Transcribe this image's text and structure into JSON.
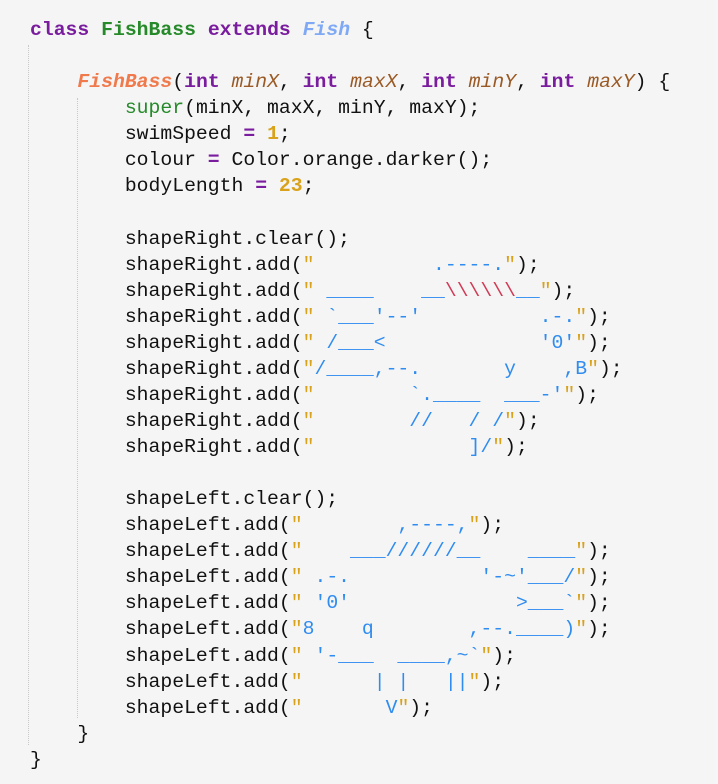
{
  "editor": {
    "colors": {
      "keyword": "#7a1c9e",
      "class_name": "#268a2a",
      "super_class": "#7fa9f5",
      "constructor": "#f07a4c",
      "param": "#9a5a26",
      "number": "#d9a21b",
      "string": "#2f8cf0",
      "escape": "#d03a55",
      "background": "#f5f5f5"
    },
    "lines": [
      [
        [
          "k",
          "class"
        ],
        [
          "t",
          " "
        ],
        [
          "c",
          "FishBass"
        ],
        [
          "t",
          " "
        ],
        [
          "k",
          "extends"
        ],
        [
          "t",
          " "
        ],
        [
          "ci",
          "Fish"
        ],
        [
          "t",
          " {"
        ]
      ],
      [],
      [
        [
          "t",
          "    "
        ],
        [
          "fn",
          "FishBass"
        ],
        [
          "t",
          "("
        ],
        [
          "k",
          "int"
        ],
        [
          "t",
          " "
        ],
        [
          "p",
          "minX"
        ],
        [
          "t",
          ", "
        ],
        [
          "k",
          "int"
        ],
        [
          "t",
          " "
        ],
        [
          "p",
          "maxX"
        ],
        [
          "t",
          ", "
        ],
        [
          "k",
          "int"
        ],
        [
          "t",
          " "
        ],
        [
          "p",
          "minY"
        ],
        [
          "t",
          ", "
        ],
        [
          "k",
          "int"
        ],
        [
          "t",
          " "
        ],
        [
          "p",
          "maxY"
        ],
        [
          "t",
          ") {"
        ]
      ],
      [
        [
          "t",
          "        "
        ],
        [
          "g",
          "super"
        ],
        [
          "t",
          "(minX, maxX, minY, maxY);"
        ]
      ],
      [
        [
          "t",
          "        swimSpeed "
        ],
        [
          "op",
          "="
        ],
        [
          "t",
          " "
        ],
        [
          "n",
          "1"
        ],
        [
          "t",
          ";"
        ]
      ],
      [
        [
          "t",
          "        colour "
        ],
        [
          "op",
          "="
        ],
        [
          "t",
          " Color.orange.darker();"
        ]
      ],
      [
        [
          "t",
          "        bodyLength "
        ],
        [
          "op",
          "="
        ],
        [
          "t",
          " "
        ],
        [
          "n",
          "23"
        ],
        [
          "t",
          ";"
        ]
      ],
      [],
      [
        [
          "t",
          "        shapeRight.clear();"
        ]
      ],
      [
        [
          "t",
          "        shapeRight.add("
        ],
        [
          "q",
          "\""
        ],
        [
          "s",
          "          .----."
        ],
        [
          "q",
          "\""
        ],
        [
          "t",
          ");"
        ]
      ],
      [
        [
          "t",
          "        shapeRight.add("
        ],
        [
          "q",
          "\""
        ],
        [
          "s",
          " ____    __"
        ],
        [
          "e",
          "\\\\\\\\\\\\"
        ],
        [
          "s",
          "__"
        ],
        [
          "q",
          "\""
        ],
        [
          "t",
          ");"
        ]
      ],
      [
        [
          "t",
          "        shapeRight.add("
        ],
        [
          "q",
          "\""
        ],
        [
          "s",
          " `___'--'          .-."
        ],
        [
          "q",
          "\""
        ],
        [
          "t",
          ");"
        ]
      ],
      [
        [
          "t",
          "        shapeRight.add("
        ],
        [
          "q",
          "\""
        ],
        [
          "s",
          " /___<             '0'"
        ],
        [
          "q",
          "\""
        ],
        [
          "t",
          ");"
        ]
      ],
      [
        [
          "t",
          "        shapeRight.add("
        ],
        [
          "q",
          "\""
        ],
        [
          "s",
          "/____,--.       y    ,B"
        ],
        [
          "q",
          "\""
        ],
        [
          "t",
          ");"
        ]
      ],
      [
        [
          "t",
          "        shapeRight.add("
        ],
        [
          "q",
          "\""
        ],
        [
          "s",
          "        `.____  ___-'"
        ],
        [
          "q",
          "\""
        ],
        [
          "t",
          ");"
        ]
      ],
      [
        [
          "t",
          "        shapeRight.add("
        ],
        [
          "q",
          "\""
        ],
        [
          "s",
          "        //   / /"
        ],
        [
          "q",
          "\""
        ],
        [
          "t",
          ");"
        ]
      ],
      [
        [
          "t",
          "        shapeRight.add("
        ],
        [
          "q",
          "\""
        ],
        [
          "s",
          "             ]/"
        ],
        [
          "q",
          "\""
        ],
        [
          "t",
          ");"
        ]
      ],
      [],
      [
        [
          "t",
          "        shapeLeft.clear();"
        ]
      ],
      [
        [
          "t",
          "        shapeLeft.add("
        ],
        [
          "q",
          "\""
        ],
        [
          "s",
          "        ,----,"
        ],
        [
          "q",
          "\""
        ],
        [
          "t",
          ");"
        ]
      ],
      [
        [
          "t",
          "        shapeLeft.add("
        ],
        [
          "q",
          "\""
        ],
        [
          "s",
          "    ___//////__    ____"
        ],
        [
          "q",
          "\""
        ],
        [
          "t",
          ");"
        ]
      ],
      [
        [
          "t",
          "        shapeLeft.add("
        ],
        [
          "q",
          "\""
        ],
        [
          "s",
          " .-.           '-~'___/"
        ],
        [
          "q",
          "\""
        ],
        [
          "t",
          ");"
        ]
      ],
      [
        [
          "t",
          "        shapeLeft.add("
        ],
        [
          "q",
          "\""
        ],
        [
          "s",
          " '0'              >___`"
        ],
        [
          "q",
          "\""
        ],
        [
          "t",
          ");"
        ]
      ],
      [
        [
          "t",
          "        shapeLeft.add("
        ],
        [
          "q",
          "\""
        ],
        [
          "s",
          "8    q        ,--.____)"
        ],
        [
          "q",
          "\""
        ],
        [
          "t",
          ");"
        ]
      ],
      [
        [
          "t",
          "        shapeLeft.add("
        ],
        [
          "q",
          "\""
        ],
        [
          "s",
          " '-___  ____,~`"
        ],
        [
          "q",
          "\""
        ],
        [
          "t",
          ");"
        ]
      ],
      [
        [
          "t",
          "        shapeLeft.add("
        ],
        [
          "q",
          "\""
        ],
        [
          "s",
          "      | |   ||"
        ],
        [
          "q",
          "\""
        ],
        [
          "t",
          ");"
        ]
      ],
      [
        [
          "t",
          "        shapeLeft.add("
        ],
        [
          "q",
          "\""
        ],
        [
          "s",
          "       V"
        ],
        [
          "q",
          "\""
        ],
        [
          "t",
          ");"
        ]
      ],
      [
        [
          "t",
          "    }"
        ]
      ],
      [
        [
          "t",
          "}"
        ]
      ]
    ]
  }
}
